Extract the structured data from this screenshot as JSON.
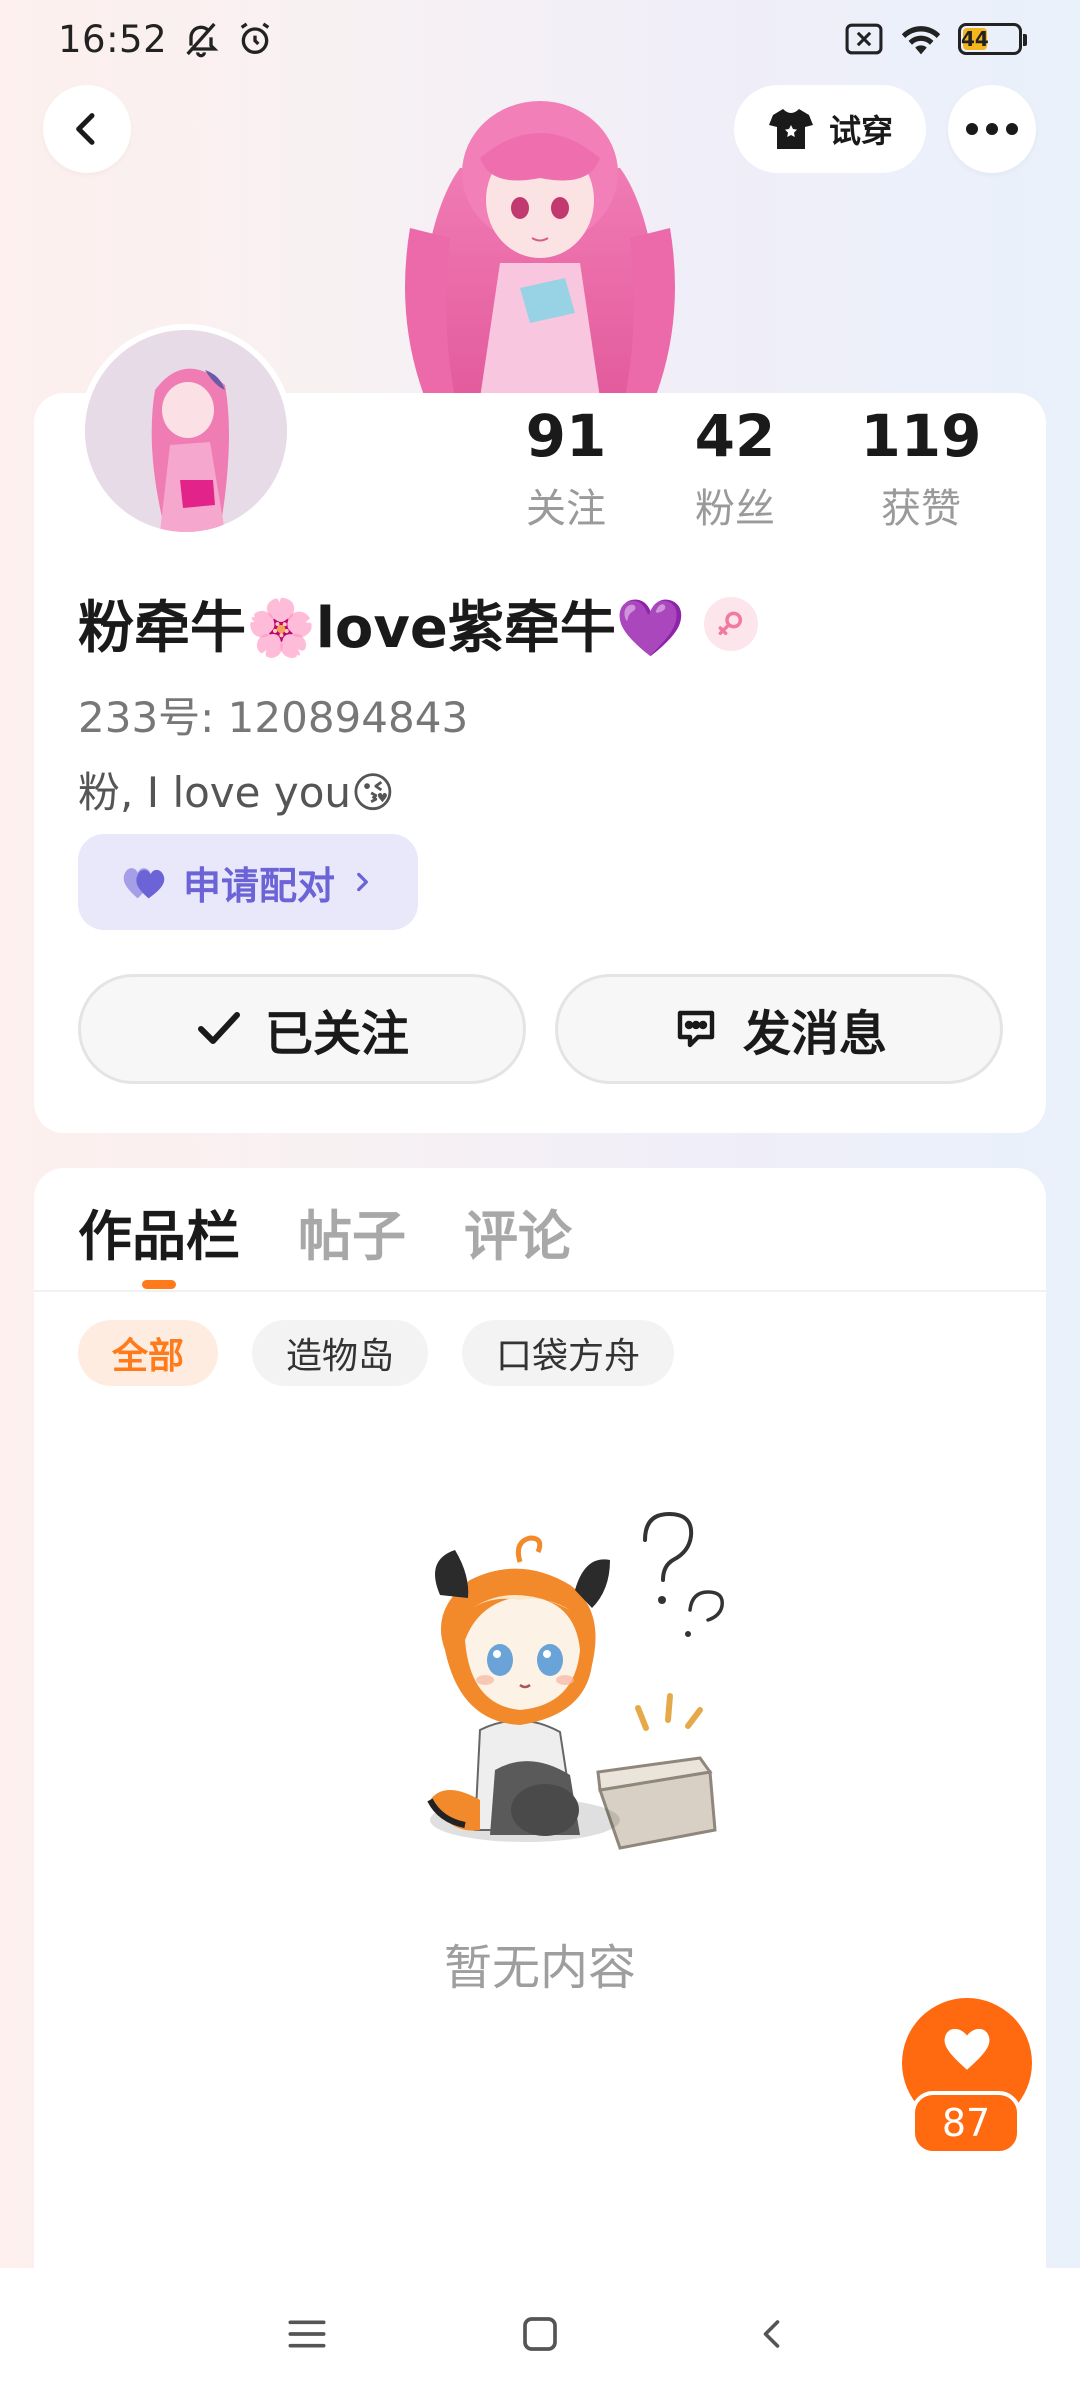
{
  "status_bar": {
    "time": "16:52",
    "battery_level": "44"
  },
  "header": {
    "try_on_label": "试穿"
  },
  "profile": {
    "stats": [
      {
        "value": "91",
        "label": "关注"
      },
      {
        "value": "42",
        "label": "粉丝"
      },
      {
        "value": "119",
        "label": "获赞"
      }
    ],
    "name": "粉牵牛🌸love紫牵牛💜",
    "gender": "female",
    "user_id": "233号: 120894843",
    "bio": "粉, I love you😘",
    "pair_label": "申请配对",
    "followed_label": "已关注",
    "message_label": "发消息"
  },
  "works": {
    "tabs": [
      "作品栏",
      "帖子",
      "评论"
    ],
    "active_tab": 0,
    "filters": [
      "全部",
      "造物岛",
      "口袋方舟"
    ],
    "active_filter": 0,
    "empty_text": "暂无内容"
  },
  "like_fab": {
    "count": "87"
  },
  "colors": {
    "accent": "#ff7a1a",
    "pair": "#6b63d6",
    "pair_bg": "#e9e8fb"
  }
}
